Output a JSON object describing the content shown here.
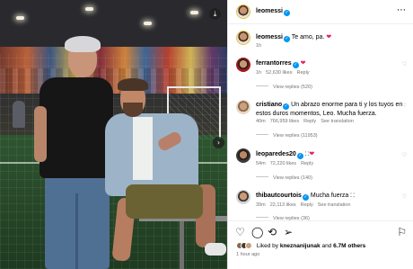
{
  "photo": {
    "download_icon": "download-icon",
    "next_icon": "chevron-right-icon"
  },
  "header": {
    "username": "leomessi",
    "more_icon": "more-horizontal-icon"
  },
  "caption": {
    "username": "leomessi",
    "text": "Te amo, pa.",
    "time": "1h"
  },
  "comments": [
    {
      "username": "ferrantorres",
      "text": "",
      "time": "1h",
      "likes": "52,630 likes",
      "reply": "Reply",
      "view_replies": "View replies (520)"
    },
    {
      "username": "cristiano",
      "text": "Un abrazo enorme para ti y los tuyos en estos duros momentos, Leo. Mucha fuerza.",
      "time": "40m",
      "likes": "766,959 likes",
      "reply": "Reply",
      "translation": "See translation",
      "view_replies": "View replies (11953)"
    },
    {
      "username": "leoparedes20",
      "text": "",
      "time": "54m",
      "likes": "72,220 likes",
      "reply": "Reply",
      "view_replies": "View replies (140)"
    },
    {
      "username": "thibautcourtois",
      "text": "Mucha fuerza",
      "time": "39m",
      "likes": "22,113 likes",
      "reply": "Reply",
      "translation": "See translation",
      "view_replies": "View replies (36)"
    }
  ],
  "actions": {
    "like_icon": "heart-icon",
    "comment_icon": "comment-icon",
    "repost_icon": "repost-icon",
    "share_icon": "share-icon",
    "save_icon": "bookmark-icon"
  },
  "likes": {
    "prefix": "Liked by",
    "user": "kneznanijunak",
    "joiner": "and",
    "others": "6.7M others"
  },
  "posted": "1 hour ago",
  "colors": {
    "verified": "#0095f6",
    "heart": "#e0245e",
    "muted": "#737373"
  }
}
